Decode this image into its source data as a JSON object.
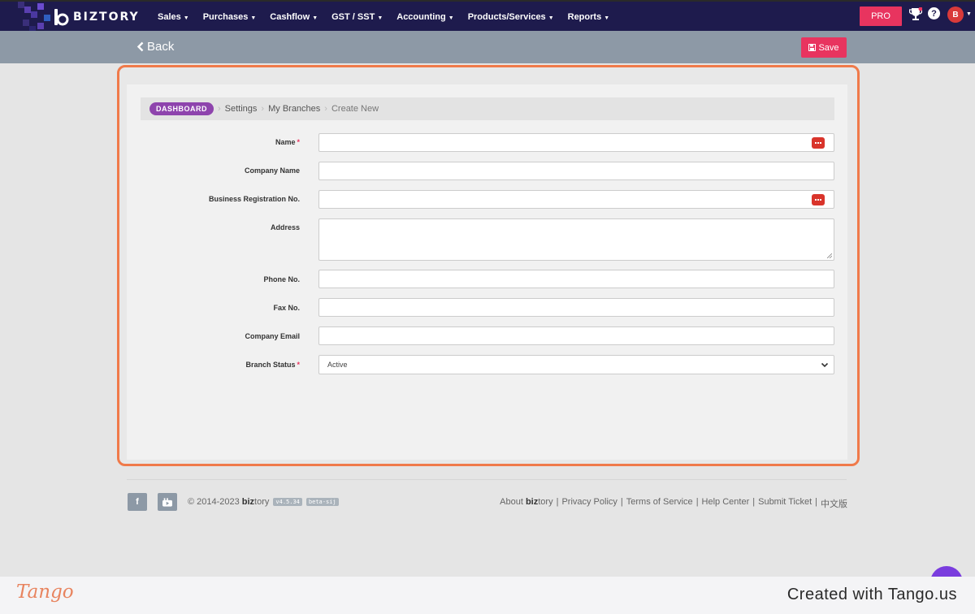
{
  "app": {
    "brand": "BIZTORY"
  },
  "nav": {
    "items": [
      {
        "label": "Sales"
      },
      {
        "label": "Purchases"
      },
      {
        "label": "Cashflow"
      },
      {
        "label": "GST / SST"
      },
      {
        "label": "Accounting"
      },
      {
        "label": "Products/Services"
      },
      {
        "label": "Reports"
      }
    ],
    "pro_label": "PRO",
    "avatar_initial": "B",
    "help_label": "?"
  },
  "toolbar": {
    "back_label": "Back",
    "save_label": "Save"
  },
  "breadcrumb": {
    "dashboard": "DASHBOARD",
    "items": [
      "Settings",
      "My Branches"
    ],
    "current": "Create New"
  },
  "form": {
    "name_label": "Name",
    "company_name_label": "Company Name",
    "brn_label": "Business Registration No.",
    "address_label": "Address",
    "phone_label": "Phone No.",
    "fax_label": "Fax No.",
    "email_label": "Company Email",
    "status_label": "Branch Status",
    "status_value": "Active",
    "required_mark": "*"
  },
  "footer": {
    "copyright_prefix": "© 2014-2023",
    "brand_bold": "biz",
    "brand_rest": "tory",
    "version": "v4.5.34",
    "tag": "beta-sij",
    "links": {
      "about_prefix": "About",
      "about_bold": "biz",
      "about_rest": "tory",
      "privacy": "Privacy Policy",
      "terms": "Terms of Service",
      "help": "Help Center",
      "ticket": "Submit Ticket",
      "chinese": "中文版",
      "separator": "|"
    }
  },
  "tango": {
    "logo": "Tango",
    "credit": "Created with Tango.us"
  },
  "colors": {
    "nav_bg": "#1e1b4d",
    "accent": "#e8345f",
    "highlight": "#f07a4a",
    "breadcrumb_badge": "#8e44ad"
  }
}
